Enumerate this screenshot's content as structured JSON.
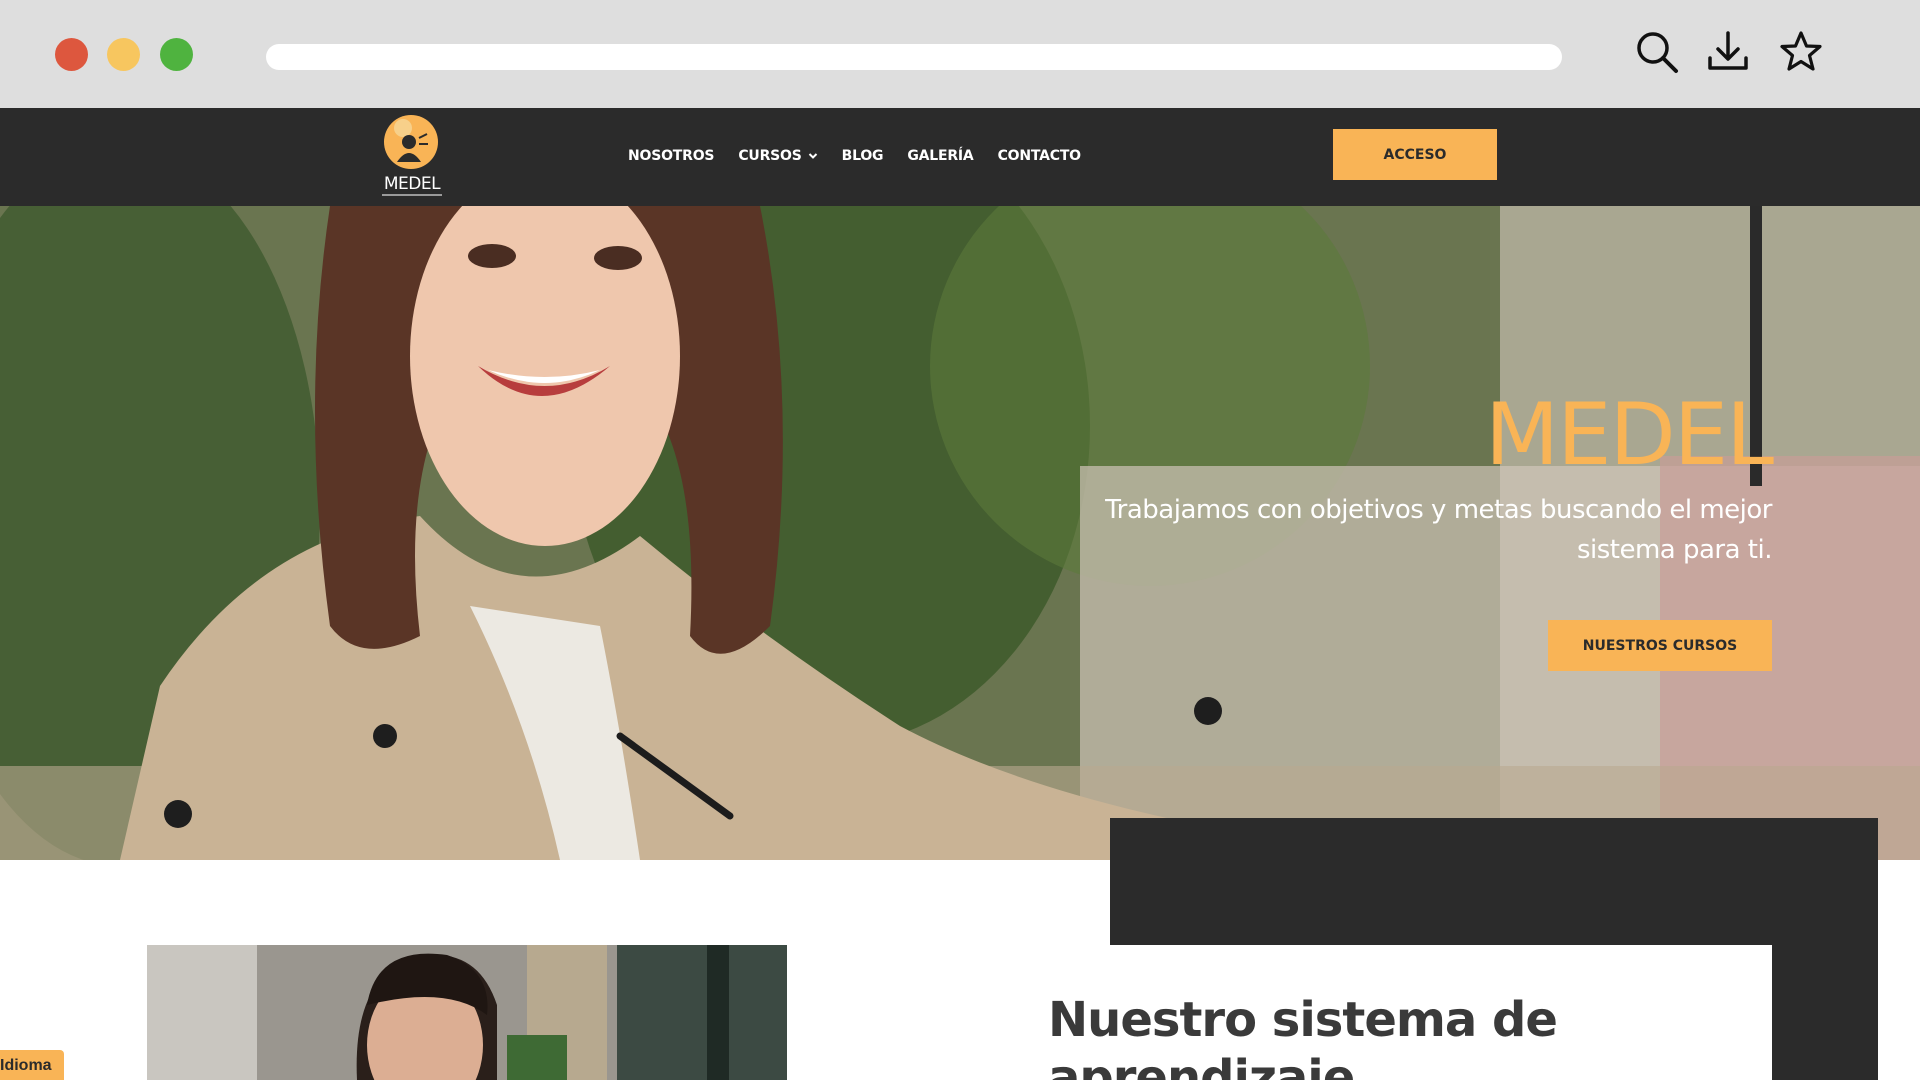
{
  "theme": {
    "accent": "#f9b456",
    "dark": "#2b2b2b",
    "traffic_red": "#dd573e",
    "traffic_yellow": "#f7c65f",
    "traffic_green": "#4fb33f"
  },
  "browser": {
    "icons": [
      "search-icon",
      "download-icon",
      "star-icon"
    ]
  },
  "header": {
    "logo_text": "MEDEL",
    "nav": [
      {
        "label": "NOSOTROS"
      },
      {
        "label": "CURSOS",
        "has_dropdown": true
      },
      {
        "label": "BLOG"
      },
      {
        "label": "GALERÍA"
      },
      {
        "label": "CONTACTO"
      }
    ],
    "acceso_label": "ACCESO"
  },
  "hero": {
    "title": "MEDEL",
    "subtitle": "Trabajamos con objetivos y metas buscando el mejor sistema para ti.",
    "cta_label": "NUESTROS CURSOS"
  },
  "section": {
    "title": "Nuestro sistema de aprendizaje"
  },
  "language_tab": {
    "label": "Idioma"
  }
}
